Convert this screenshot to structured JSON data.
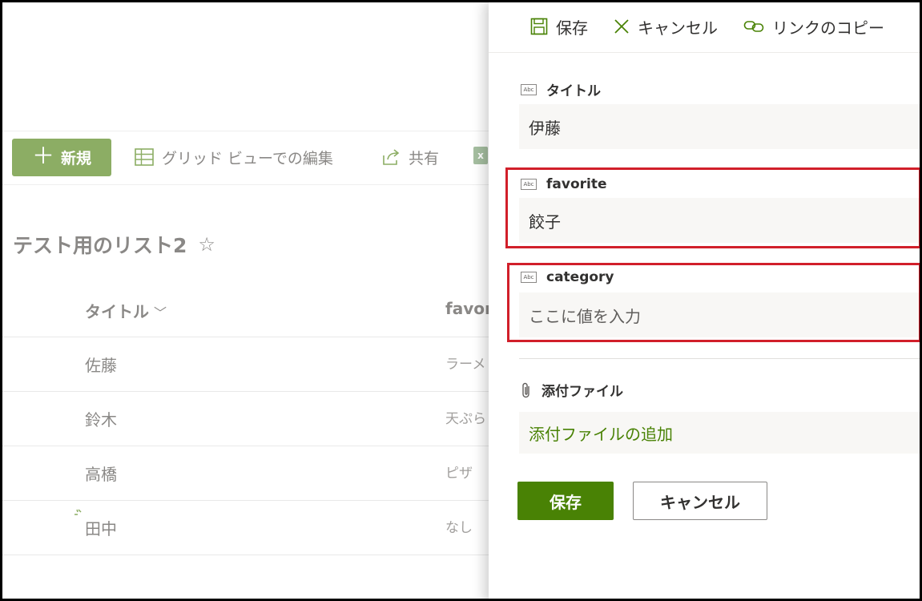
{
  "command_bar": {
    "new_label": "新規",
    "grid_edit_label": "グリッド ビューでの編集",
    "share_label": "共有",
    "excel_icon_letter": "x"
  },
  "list": {
    "title": "テスト用のリスト2",
    "columns": [
      {
        "label": "タイトル"
      },
      {
        "label": "favori"
      }
    ],
    "rows": [
      {
        "title": "佐藤",
        "favorite": "ラーメ"
      },
      {
        "title": "鈴木",
        "favorite": "天ぷら"
      },
      {
        "title": "高橋",
        "favorite": "ピザ"
      },
      {
        "title": "田中",
        "favorite": "なし"
      }
    ]
  },
  "panel": {
    "toolbar": {
      "save_label": "保存",
      "cancel_label": "キャンセル",
      "copy_link_label": "リンクのコピー"
    },
    "fields": {
      "title": {
        "label": "タイトル",
        "value": "伊藤"
      },
      "favorite": {
        "label": "favorite",
        "value": "餃子"
      },
      "category": {
        "label": "category",
        "placeholder": "ここに値を入力"
      }
    },
    "attachments": {
      "label": "添付ファイル",
      "add_label": "添付ファイルの追加"
    },
    "buttons": {
      "save": "保存",
      "cancel": "キャンセル"
    }
  },
  "colors": {
    "accent_green": "#498205",
    "new_button_dimmed": "#8cad64",
    "highlight_red": "#d11f2a"
  }
}
